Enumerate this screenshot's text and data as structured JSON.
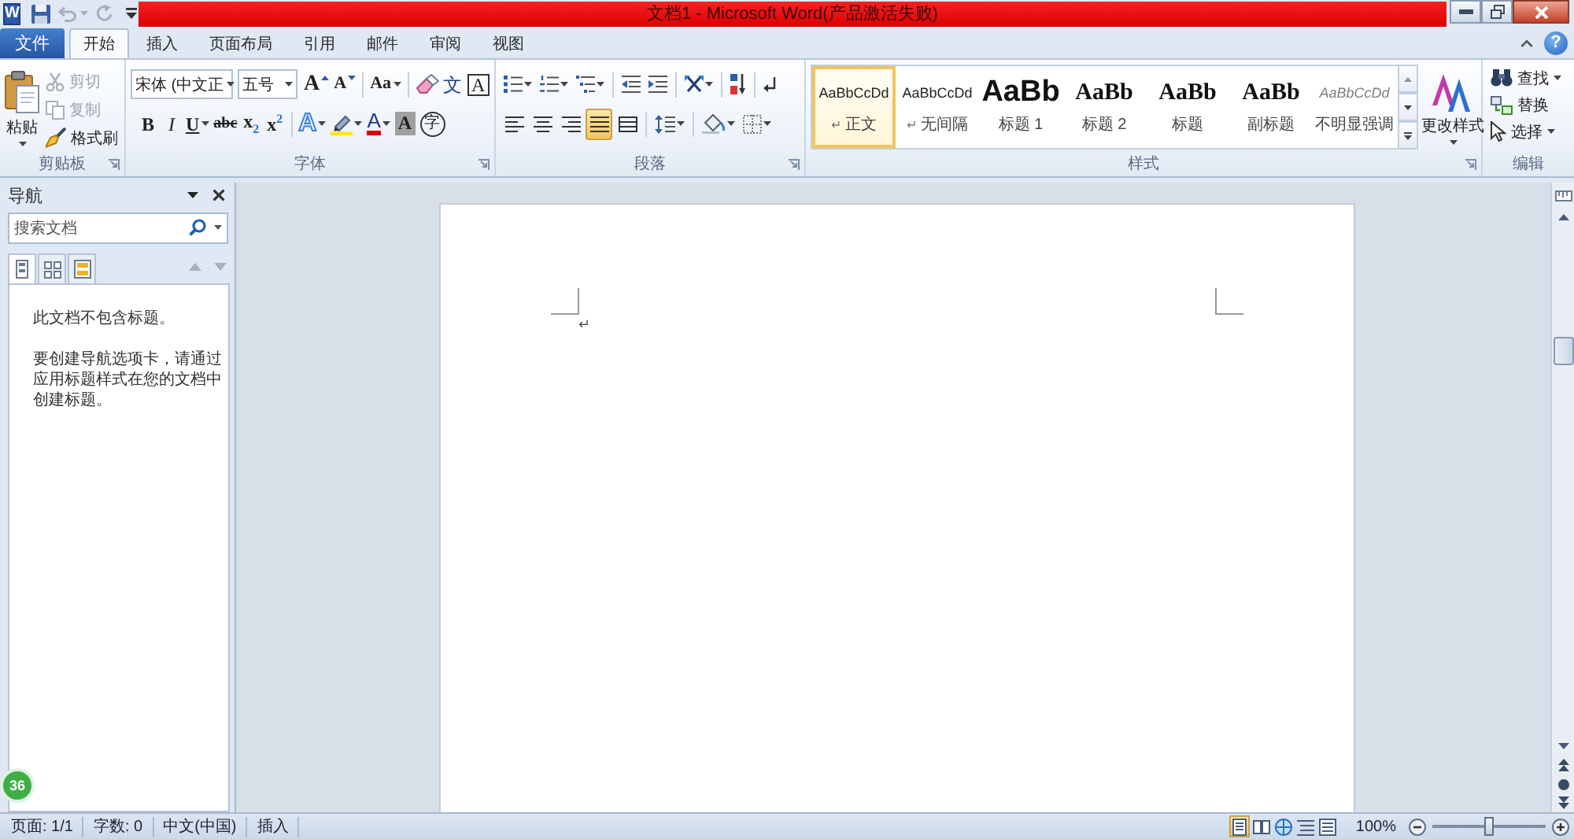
{
  "title_bar": {
    "app_logo": "W",
    "quick_access": [
      {
        "kind": "save",
        "disabled": false
      },
      {
        "kind": "undo",
        "disabled": true
      },
      {
        "kind": "redo",
        "disabled": true
      }
    ],
    "title": "文档1 - Microsoft Word(产品激活失败)"
  },
  "tabs": [
    {
      "label": "文件",
      "kind": "file",
      "selected": false
    },
    {
      "label": "开始",
      "kind": "tab",
      "selected": true
    },
    {
      "label": "插入",
      "kind": "tab",
      "selected": false
    },
    {
      "label": "页面布局",
      "kind": "tab",
      "selected": false
    },
    {
      "label": "引用",
      "kind": "tab",
      "selected": false
    },
    {
      "label": "邮件",
      "kind": "tab",
      "selected": false
    },
    {
      "label": "审阅",
      "kind": "tab",
      "selected": false
    },
    {
      "label": "视图",
      "kind": "tab",
      "selected": false
    }
  ],
  "help": "?",
  "ribbon": {
    "clipboard": {
      "label": "剪贴板",
      "paste": "粘贴",
      "buttons": [
        {
          "label": "剪切",
          "kind": "cut",
          "disabled": true
        },
        {
          "label": "复制",
          "kind": "copy",
          "disabled": true
        },
        {
          "label": "格式刷",
          "kind": "painter",
          "disabled": false
        }
      ]
    },
    "font": {
      "label": "字体",
      "font_name": "宋体 (中文正",
      "font_size": "五号",
      "row_1": [
        {
          "kind": "grow",
          "text": "A"
        },
        {
          "kind": "shrink",
          "text": "A"
        },
        {
          "kind": "case",
          "text": "Aa"
        },
        {
          "kind": "clear"
        },
        {
          "kind": "phonetic",
          "text": "文"
        },
        {
          "kind": "border",
          "text": "A"
        }
      ],
      "row_2": [
        {
          "kind": "bold",
          "text": "B"
        },
        {
          "kind": "italic",
          "text": "I"
        },
        {
          "kind": "underline",
          "text": "U"
        },
        {
          "kind": "strike",
          "text": "abc"
        },
        {
          "kind": "sub",
          "text": "x$_{2}$"
        },
        {
          "kind": "sup",
          "text": "x$^{2}$"
        },
        {
          "kind": "effects",
          "text": "A"
        },
        {
          "kind": "highlight"
        },
        {
          "kind": "color",
          "text": "A"
        },
        {
          "kind": "shading",
          "text": "A"
        },
        {
          "kind": "enclose",
          "text": "字"
        }
      ]
    },
    "paragraph": {
      "label": "段落",
      "alignment": [
        {
          "kind": "left",
          "selected": false
        },
        {
          "kind": "center",
          "selected": false
        },
        {
          "kind": "right",
          "selected": false
        },
        {
          "kind": "justify",
          "selected": true
        },
        {
          "kind": "distributed",
          "selected": false
        }
      ]
    },
    "styles": {
      "label": "样式",
      "gallery": [
        {
          "kind": "normal",
          "preview": "AaBbCcDd",
          "mark": "↵",
          "name": "正文",
          "selected": true
        },
        {
          "kind": "normal",
          "preview": "AaBbCcDd",
          "mark": "↵",
          "name": "无间隔",
          "selected": false
        },
        {
          "kind": "heading1",
          "preview": "AaBb",
          "name": "标题 1",
          "selected": false
        },
        {
          "kind": "heading",
          "preview": "AaBb",
          "name": "标题 2",
          "selected": false
        },
        {
          "kind": "heading",
          "preview": "AaBb",
          "name": "标题",
          "selected": false
        },
        {
          "kind": "heading",
          "preview": "AaBb",
          "name": "副标题",
          "selected": false
        },
        {
          "kind": "subtle",
          "preview": "AaBbCcDd",
          "name": "不明显强调",
          "selected": false
        }
      ],
      "change_styles": "更改样式"
    },
    "editing": {
      "label": "编辑",
      "buttons": [
        {
          "label": "查找",
          "kind": "find"
        },
        {
          "label": "替换",
          "kind": "replace"
        },
        {
          "label": "选择",
          "kind": "select"
        }
      ]
    }
  },
  "navigation": {
    "title": "导航",
    "search": {
      "placeholder": "搜索文档"
    },
    "tabs": [
      {
        "kind": "headings",
        "selected": true
      },
      {
        "kind": "pages",
        "selected": false
      },
      {
        "kind": "results",
        "selected": false
      }
    ],
    "browse": [
      {
        "kind": "previous",
        "disabled": true
      },
      {
        "kind": "next",
        "disabled": true
      }
    ],
    "messages": [
      "此文档不包含标题。",
      "要创建导航选项卡，请通过应用标题样式在您的文档中创建标题。"
    ]
  },
  "document": {
    "paragraph_mark": "↵"
  },
  "status_bar": {
    "items": [
      "页面: 1/1",
      "字数: 0",
      "中文(中国)",
      "插入"
    ],
    "views": [
      {
        "kind": "print",
        "selected": true
      },
      {
        "kind": "reading",
        "selected": false
      },
      {
        "kind": "web",
        "selected": false
      },
      {
        "kind": "outline",
        "selected": false
      },
      {
        "kind": "draft",
        "selected": false
      }
    ],
    "zoom": "100%",
    "zoom_slider": {
      "level": 0.5
    }
  },
  "floating_badge": "36"
}
